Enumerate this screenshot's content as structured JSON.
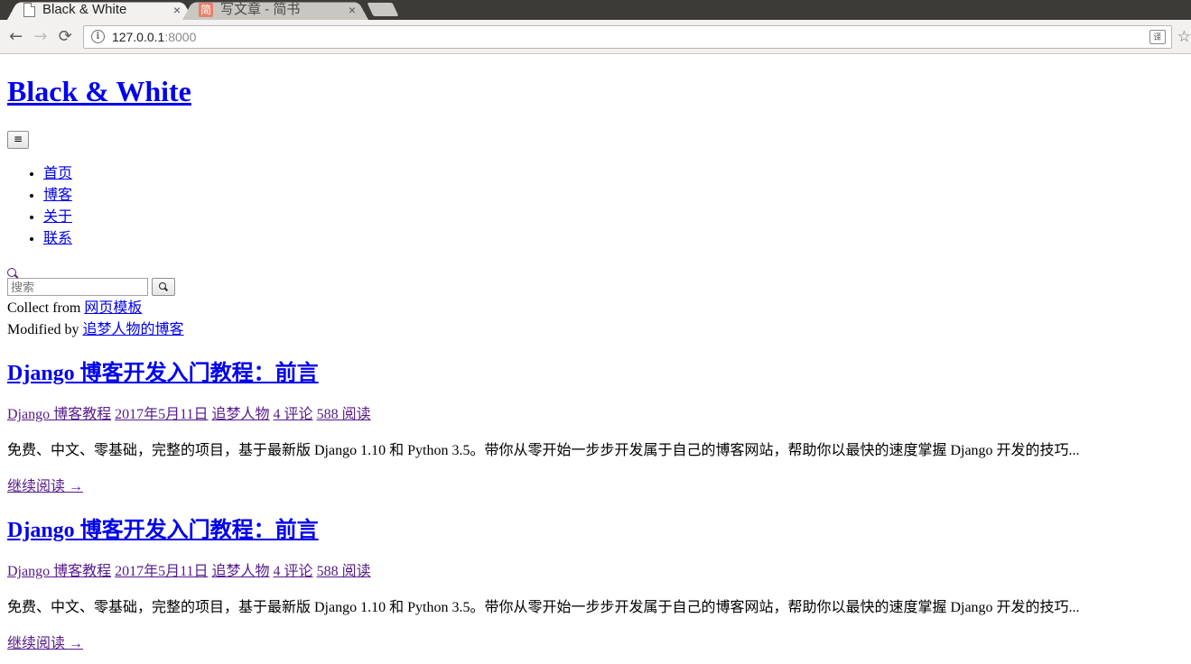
{
  "browser": {
    "tabs": [
      {
        "title": "Black & White",
        "favicon": "page-icon",
        "active": true,
        "close": "×"
      },
      {
        "title": "写文章 - 简书",
        "favicon": "jianshu-icon",
        "favicon_text": "简",
        "active": false,
        "close": "×"
      }
    ],
    "nav": {
      "back": "←",
      "forward": "→",
      "reload": "⟳"
    },
    "address": {
      "host": "127.0.0.1",
      "port": ":8000",
      "info_icon": "i",
      "translate_icon": "译",
      "bookmark": "☆"
    }
  },
  "site": {
    "title": "Black & White",
    "menu_toggle": "≡",
    "nav": [
      "首页",
      "博客",
      "关于",
      "联系"
    ],
    "search": {
      "placeholder": "搜索"
    },
    "credits": [
      {
        "prefix": "Collect from ",
        "link": "网页模板"
      },
      {
        "prefix": "Modified by ",
        "link": "追梦人物的博客"
      }
    ]
  },
  "posts": [
    {
      "title": "Django 博客开发入门教程：前言",
      "category": "Django 博客教程",
      "date": "2017年5月11日",
      "author": "追梦人物",
      "comments": "4 评论",
      "views": "588 阅读",
      "excerpt": "免费、中文、零基础，完整的项目，基于最新版 Django 1.10 和 Python 3.5。带你从零开始一步步开发属于自己的博客网站，帮助你以最快的速度掌握 Django 开发的技巧...",
      "read_more": "继续阅读 →"
    },
    {
      "title": "Django 博客开发入门教程：前言",
      "category": "Django 博客教程",
      "date": "2017年5月11日",
      "author": "追梦人物",
      "comments": "4 评论",
      "views": "588 阅读",
      "excerpt": "免费、中文、零基础，完整的项目，基于最新版 Django 1.10 和 Python 3.5。带你从零开始一步步开发属于自己的博客网站，帮助你以最快的速度掌握 Django 开发的技巧...",
      "read_more": "继续阅读 →"
    }
  ],
  "colors": {
    "link": "#0000ee",
    "visited": "#551a8b",
    "chrome_dark": "#3c3b37",
    "chrome_light": "#f2f1f0"
  }
}
